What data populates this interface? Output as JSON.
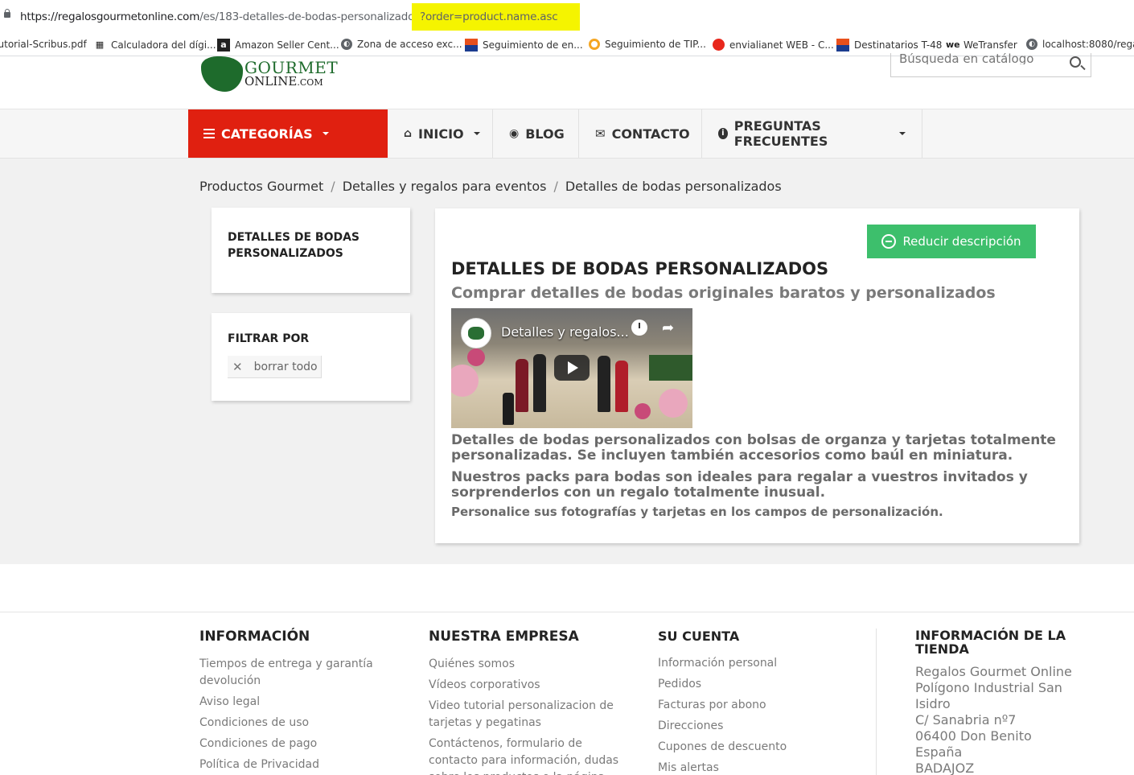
{
  "browser": {
    "url_host": "https://regalosgourmetonline.com",
    "url_path": "/es/183-detalles-de-bodas-personalizados",
    "url_query": "?order=product.name.asc",
    "bookmarks": [
      {
        "label": "Tutorial-Scribus.pdf",
        "icon": "none"
      },
      {
        "label": "Calculadora del dígi...",
        "icon": "calculator-icon"
      },
      {
        "label": "Amazon Seller Cent...",
        "icon": "amazon-icon"
      },
      {
        "label": "Zona de acceso exc...",
        "icon": "globe-icon"
      },
      {
        "label": "Seguimiento de en...",
        "icon": "flag-icon"
      },
      {
        "label": "Seguimiento de TIP...",
        "icon": "ring-icon"
      },
      {
        "label": "envialianet WEB - C...",
        "icon": "stop-icon"
      },
      {
        "label": "Destinatarios T-48",
        "icon": "flag-icon"
      },
      {
        "label": "WeTransfer",
        "icon": "wetransfer-icon"
      },
      {
        "label": "localhost:8080/rega...",
        "icon": "globe-icon"
      }
    ]
  },
  "header": {
    "logo_line1": "GOURMET",
    "logo_line2": "ONLINE",
    "logo_suffix": ".COM",
    "search_placeholder": "Búsqueda en catálogo"
  },
  "nav": {
    "categories": "CATEGORÍAS",
    "items": [
      {
        "label": "INICIO",
        "icon": "home-icon",
        "dropdown": true
      },
      {
        "label": "BLOG",
        "icon": "eye-icon",
        "dropdown": false
      },
      {
        "label": "CONTACTO",
        "icon": "envelope-icon",
        "dropdown": false
      },
      {
        "label": "PREGUNTAS FRECUENTES",
        "icon": "info-icon",
        "dropdown": true
      }
    ]
  },
  "breadcrumb": [
    "Productos Gourmet",
    "Detalles y regalos para eventos",
    "Detalles de bodas personalizados"
  ],
  "sidebar": {
    "category_title": "DETALLES DE BODAS PERSONALIZADOS",
    "filter_title": "FILTRAR POR",
    "clear_all": "borrar todo"
  },
  "content": {
    "reduce_button": "Reducir descripción",
    "title": "DETALLES DE BODAS PERSONALIZADOS",
    "subtitle": "Comprar detalles de bodas originales baratos y personalizados",
    "video_title": "Detalles y regalos...",
    "para1": "Detalles de bodas personalizados con bolsas de organza y tarjetas totalmente personalizadas. Se incluyen también accesorios como baúl en miniatura.",
    "para2": "Nuestros packs para bodas son ideales para regalar a vuestros invitados y sorprenderlos con un regalo totalmente inusual.",
    "para3": "Personalice sus fotografías y tarjetas en los campos de personalización."
  },
  "footer": {
    "info": {
      "title": "INFORMACIÓN",
      "links": [
        "Tiempos de entrega y garantía devolución",
        "Aviso legal",
        "Condiciones de uso",
        "Condiciones de pago",
        "Política de Privacidad"
      ]
    },
    "company": {
      "title": "NUESTRA EMPRESA",
      "links": [
        "Quiénes somos",
        "Vídeos corporativos",
        "Video tutorial personalizacion de tarjetas y pegatinas",
        "Contáctenos, formulario de contacto para información, dudas sobre los productos o la página, pedidos y"
      ]
    },
    "account": {
      "title": "SU CUENTA",
      "links": [
        "Información personal",
        "Pedidos",
        "Facturas por abono",
        "Direcciones",
        "Cupones de descuento",
        "Mis alertas"
      ]
    },
    "store": {
      "title": "INFORMACIÓN DE LA TIENDA",
      "address": [
        "Regalos Gourmet Online",
        "Polígono Industrial San Isidro",
        "C/ Sanabria nº7",
        "06400 Don Benito",
        "España",
        "BADAJOZ"
      ]
    }
  },
  "colors": {
    "categories_bg": "#e02010",
    "reduce_button_bg": "#3dbf6c",
    "url_highlight": "#f5f400",
    "logo_green": "#1e6b2c"
  }
}
